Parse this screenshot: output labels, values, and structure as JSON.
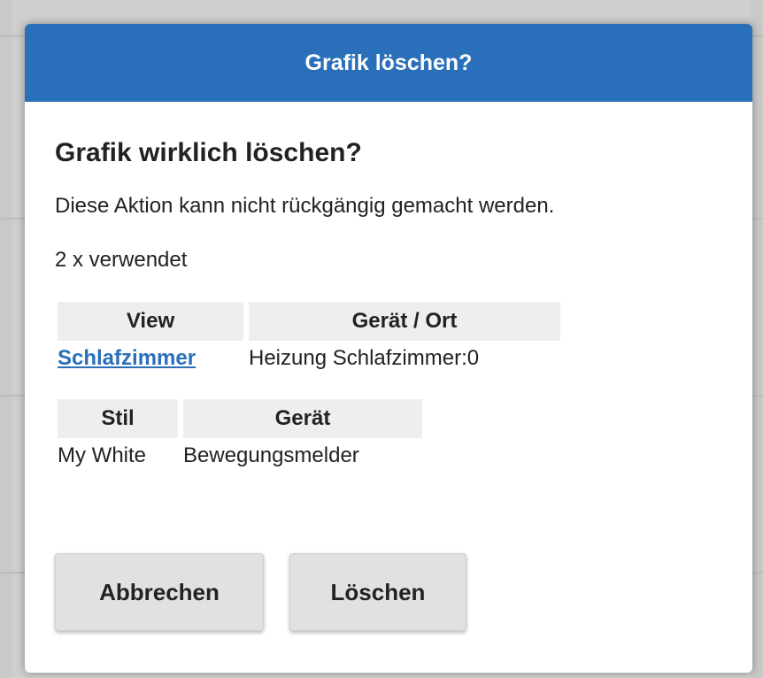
{
  "dialog": {
    "title": "Grafik löschen?",
    "question": "Grafik wirklich löschen?",
    "warning": "Diese Aktion kann nicht rückgängig gemacht werden.",
    "usage_count": "2 x verwendet",
    "views_table": {
      "headers": [
        "View",
        "Gerät / Ort"
      ],
      "rows": [
        [
          "Schlafzimmer",
          "Heizung Schlafzimmer:0"
        ]
      ]
    },
    "styles_table": {
      "headers": [
        "Stil",
        "Gerät"
      ],
      "rows": [
        [
          "My White",
          "Bewegungsmelder"
        ]
      ]
    },
    "buttons": {
      "cancel": "Abbrechen",
      "delete": "Löschen"
    }
  },
  "colors": {
    "header": "#2a6fb9",
    "link": "#2a6fb9",
    "button_bg": "#e1e1e1",
    "table_header_bg": "#eeeeee"
  }
}
